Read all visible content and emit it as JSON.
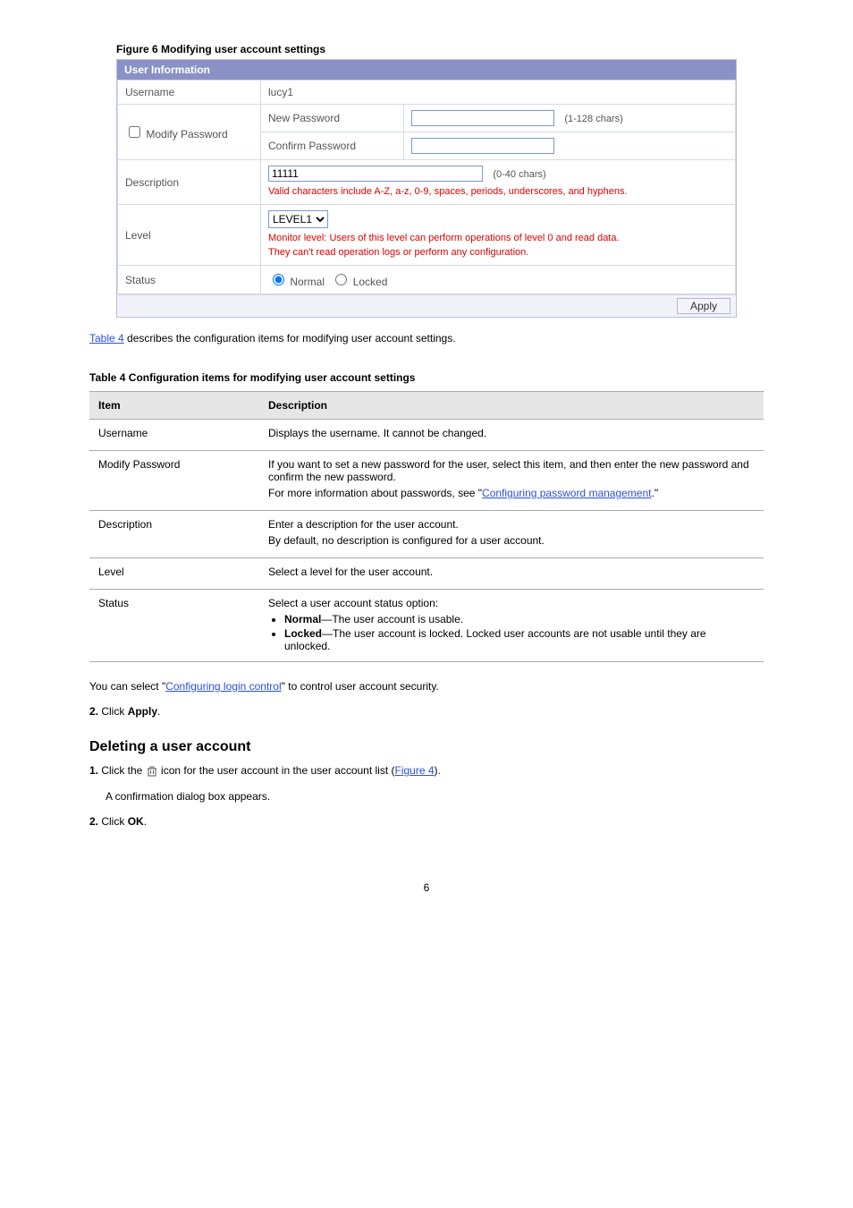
{
  "figure_caption": "Figure 6 Modifying user account settings",
  "panel": {
    "header": "User Information",
    "rows": {
      "username_label": "Username",
      "username_value": "lucy1",
      "modify_password_label": "Modify Password",
      "new_password_label": "New Password",
      "new_password_hint": "(1-128  chars)",
      "confirm_password_label": "Confirm Password",
      "description_label": "Description",
      "description_value": "11111",
      "description_hint": "(0-40  chars)",
      "description_note": "Valid characters include A-Z, a-z, 0-9, spaces, periods, underscores, and hyphens.",
      "level_label": "Level",
      "level_value": "LEVEL1",
      "level_note_line1": "Monitor level: Users of this level can perform operations of level 0 and read data.",
      "level_note_line2": "They can't read operation logs or perform any configuration.",
      "status_label": "Status",
      "status_normal": "Normal",
      "status_locked": "Locked"
    },
    "apply_button": "Apply"
  },
  "table_caption_before": "Table 4",
  "table_caption_after": " describes the configuration items for modifying user account settings.",
  "cfg_table": {
    "title": "Table 4 Configuration items for modifying user account settings",
    "header_item": "Item",
    "header_desc": "Description",
    "rows": [
      {
        "item": "Username",
        "desc_lines": [
          "Displays the username. It cannot be changed."
        ]
      },
      {
        "item": "Modify Password",
        "desc_lines": [
          "If you want to set a new password for the user, select this item, and then enter the new password and confirm the new password.",
          "For more information about passwords, see \""
        ],
        "desc_link": "Configuring password management",
        "desc_after_link": ".\""
      },
      {
        "item": "Description",
        "desc_lines": [
          "Enter a description for the user account.",
          "By default, no description is configured for a user account."
        ]
      },
      {
        "item": "Level",
        "desc_lines": [
          "Select a level for the user account."
        ]
      },
      {
        "item": "Status",
        "desc_lines": [
          "Select a user account status option:"
        ],
        "bullets": [
          {
            "bold": "Normal",
            "rest": "—The user account is usable."
          },
          {
            "bold": "Locked",
            "rest": "—The user account is locked. Locked user accounts are not usable until they are unlocked."
          }
        ]
      }
    ]
  },
  "link_login": "Configuring login control",
  "para_after_link": " to control user account security.",
  "para_2_prefix": "2. ",
  "para_2_text": "Click ",
  "section_heading": "Deleting a user account",
  "del_para_1_prefix": "1. ",
  "del_para_1_pref_text": "Click the ",
  "del_para_1_mid": " icon for the user account in the user account list (",
  "del_link": "Figure 4",
  "del_para_1_after": ").",
  "del_para_2": "A confirmation dialog box appears.",
  "del_para_3_prefix": "2. ",
  "del_para_3_text_before": "Click ",
  "del_para_3_bold": "OK",
  "del_para_3_after": ".",
  "page_number": "6",
  "icons": {
    "delete_alt": "delete"
  }
}
